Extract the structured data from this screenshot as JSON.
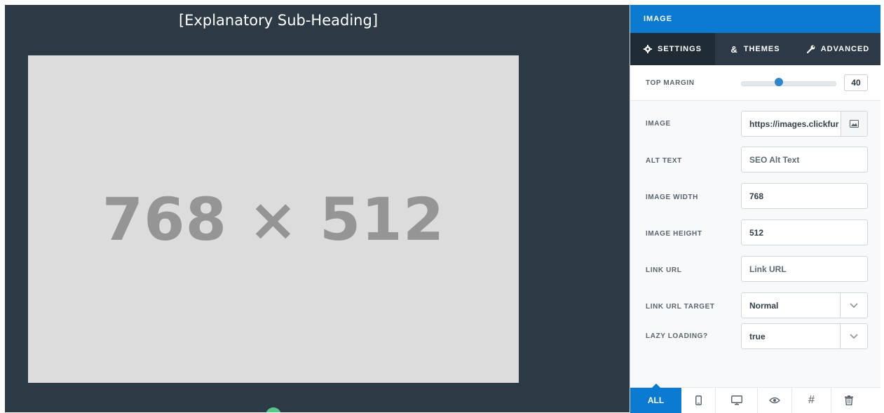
{
  "canvas": {
    "subheading": "[Explanatory Sub-Heading]",
    "placeholder_text": "768 × 512"
  },
  "panel": {
    "title": "IMAGE",
    "tabs": [
      {
        "label": "SETTINGS",
        "icon": "gear-icon",
        "active": true
      },
      {
        "label": "THEMES",
        "icon": "ampersand-icon",
        "active": false
      },
      {
        "label": "ADVANCED",
        "icon": "wrench-icon",
        "active": false
      }
    ],
    "top_margin": {
      "label": "TOP MARGIN",
      "value": "40",
      "slider_fraction": 0.4
    },
    "fields": {
      "image": {
        "label": "IMAGE",
        "value": "https://images.clickfur"
      },
      "alt_text": {
        "label": "ALT TEXT",
        "placeholder": "SEO Alt Text"
      },
      "image_width": {
        "label": "IMAGE WIDTH",
        "value": "768"
      },
      "image_height": {
        "label": "IMAGE HEIGHT",
        "value": "512"
      },
      "link_url": {
        "label": "LINK URL",
        "placeholder": "Link URL"
      },
      "link_url_target": {
        "label": "LINK URL TARGET",
        "value": "Normal"
      },
      "lazy_loading": {
        "label": "LAZY LOADING?",
        "value": "true"
      }
    },
    "bottom_bar": {
      "all_label": "ALL",
      "icons": [
        "mobile-icon",
        "desktop-icon",
        "eye-icon",
        "hash-icon",
        "trash-icon"
      ]
    }
  },
  "colors": {
    "canvas_bg": "#2c3a45",
    "accent": "#0a7bd1",
    "tab_bar": "#2b3a46",
    "placeholder_bg": "#dcdcdc"
  }
}
